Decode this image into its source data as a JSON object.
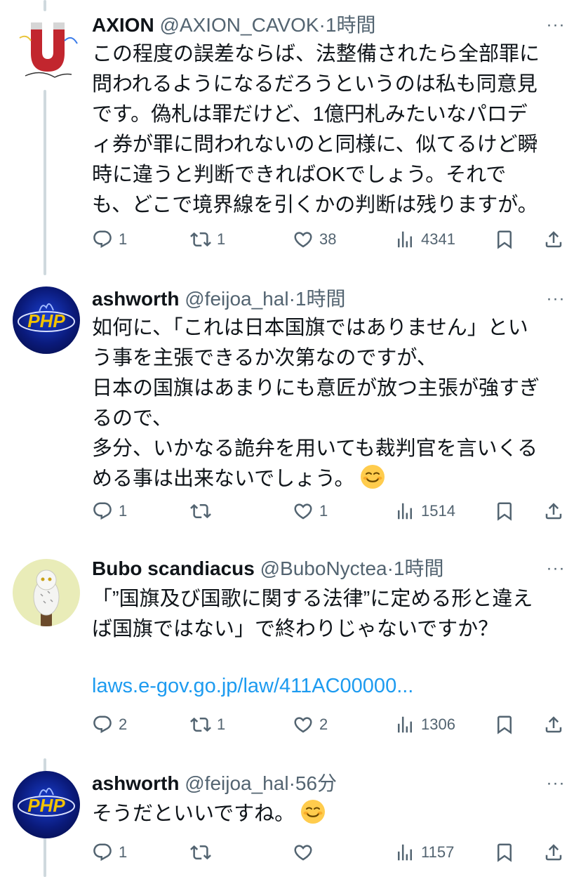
{
  "tweets": [
    {
      "name": "AXION",
      "handle": "@AXION_CAVOK",
      "dot": "·",
      "time": "1時間",
      "lines": [
        "この程度の誤差ならば、法整備されたら全部罪に",
        "問われるようになるだろうというのは私も同意見",
        "です。偽札は罪だけど、1億円札みたいなパロデ",
        "ィ券が罪に問われないのと同様に、似てるけど瞬",
        "時に違うと判断できればOKでしょう。それで",
        "も、どこで境界線を引くかの判断は残りますが。"
      ],
      "replies": "1",
      "retweets": "1",
      "likes": "38",
      "views": "4341"
    },
    {
      "name": "ashworth",
      "handle": "@feijoa_hal",
      "dot": "·",
      "time": "1時間",
      "lines": [
        "如何に、「これは日本国旗ではありません」とい",
        "う事を主張できるか次第なのですが、",
        "日本の国旗はあまりにも意匠が放つ主張が強すぎ",
        "るので、",
        "多分、いかなる詭弁を用いても裁判官を言いくる",
        "める事は出来ないでしょう。"
      ],
      "emoji": "smiling-face-emoji",
      "replies": "1",
      "retweets": "",
      "likes": "1",
      "views": "1514"
    },
    {
      "name": "Bubo scandiacus",
      "handle": "@BuboNyctea",
      "dot": "·",
      "time": "1時間",
      "lines": [
        "「”国旗及び国歌に関する法律”に定める形と違え",
        "ば国旗ではない」で終わりじゃないですか？"
      ],
      "link": "laws.e-gov.go.jp/law/411AC00000...",
      "replies": "2",
      "retweets": "1",
      "likes": "2",
      "views": "1306"
    },
    {
      "name": "ashworth",
      "handle": "@feijoa_hal",
      "dot": "·",
      "time": "56分",
      "lines": [
        "そうだといいですね。"
      ],
      "emoji": "smiling-face-emoji",
      "replies": "1",
      "retweets": "",
      "likes": "",
      "views": "1157"
    }
  ],
  "ui": {
    "more": "···"
  },
  "colors": {
    "text": "#0f1419",
    "secondary": "#536471",
    "link": "#1d9bf0",
    "thread": "#cfd9de"
  }
}
